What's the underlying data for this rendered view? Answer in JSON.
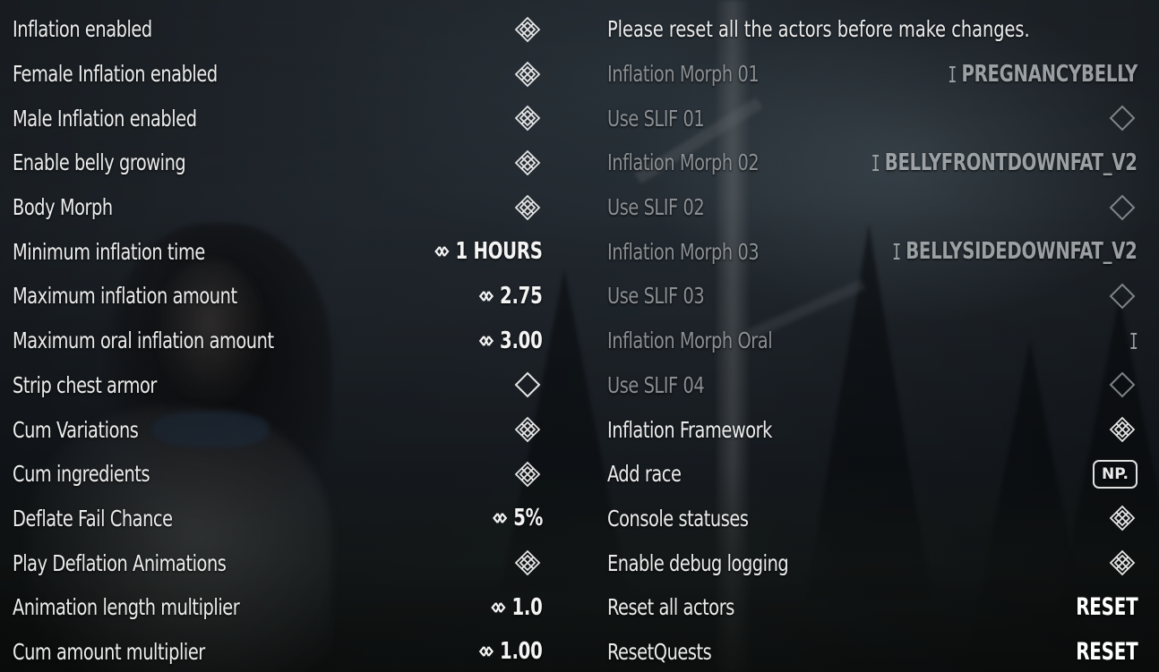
{
  "left_column": [
    {
      "label": "Inflation enabled",
      "control": "checkbox",
      "checked": true
    },
    {
      "label": "Female Inflation enabled",
      "control": "checkbox",
      "checked": true
    },
    {
      "label": "Male Inflation enabled",
      "control": "checkbox",
      "checked": true
    },
    {
      "label": "Enable belly growing",
      "control": "checkbox",
      "checked": true
    },
    {
      "label": "Body Morph",
      "control": "checkbox",
      "checked": true
    },
    {
      "label": "Minimum inflation time",
      "control": "slider",
      "value": "1 HOURS"
    },
    {
      "label": "Maximum inflation amount",
      "control": "slider",
      "value": "2.75"
    },
    {
      "label": "Maximum oral inflation amount",
      "control": "slider",
      "value": "3.00"
    },
    {
      "label": "Strip chest armor",
      "control": "checkbox",
      "checked": false
    },
    {
      "label": "Cum Variations",
      "control": "checkbox",
      "checked": true
    },
    {
      "label": "Cum ingredients",
      "control": "checkbox",
      "checked": true
    },
    {
      "label": "Deflate Fail Chance",
      "control": "slider",
      "value": "5%"
    },
    {
      "label": "Play Deflation Animations",
      "control": "checkbox",
      "checked": true
    },
    {
      "label": "Animation length multiplier",
      "control": "slider",
      "value": "1.0"
    },
    {
      "label": "Cum amount multiplier",
      "control": "slider",
      "value": "1.00"
    }
  ],
  "right_column": {
    "notice": "Please reset all the actors before make changes.",
    "rows": [
      {
        "label": "Inflation Morph 01",
        "control": "text",
        "value": "PREGNANCYBELLY",
        "disabled": true
      },
      {
        "label": "Use SLIF 01",
        "control": "checkbox",
        "checked": false,
        "disabled": true
      },
      {
        "label": "Inflation Morph 02",
        "control": "text",
        "value": "BELLYFRONTDOWNFAT_V2",
        "disabled": true
      },
      {
        "label": "Use SLIF 02",
        "control": "checkbox",
        "checked": false,
        "disabled": true
      },
      {
        "label": "Inflation Morph 03",
        "control": "text",
        "value": "BELLYSIDEDOWNFAT_V2",
        "disabled": true
      },
      {
        "label": "Use SLIF 03",
        "control": "checkbox",
        "checked": false,
        "disabled": true
      },
      {
        "label": "Inflation Morph Oral",
        "control": "text",
        "value": "",
        "disabled": true
      },
      {
        "label": "Use SLIF 04",
        "control": "checkbox",
        "checked": false,
        "disabled": true
      },
      {
        "label": "Inflation Framework",
        "control": "checkbox",
        "checked": true,
        "disabled": false
      },
      {
        "label": "Add race",
        "control": "keybadge",
        "value": "NP.",
        "disabled": false
      },
      {
        "label": "Console statuses",
        "control": "checkbox",
        "checked": true,
        "disabled": false
      },
      {
        "label": "Enable debug logging",
        "control": "checkbox",
        "checked": true,
        "disabled": false
      },
      {
        "label": "Reset all actors",
        "control": "button",
        "value": "RESET",
        "disabled": false
      },
      {
        "label": "ResetQuests",
        "control": "button",
        "value": "RESET",
        "disabled": false
      }
    ]
  },
  "icons": {
    "checkbox_checked": "checked-diamond-icon",
    "checkbox_unchecked": "empty-diamond-icon",
    "slider": "slider-icon",
    "text_input": "text-cursor-icon"
  },
  "colors": {
    "text": "#ececec",
    "disabled_text": "#8a8f93",
    "value_text": "#f4f4f4"
  }
}
